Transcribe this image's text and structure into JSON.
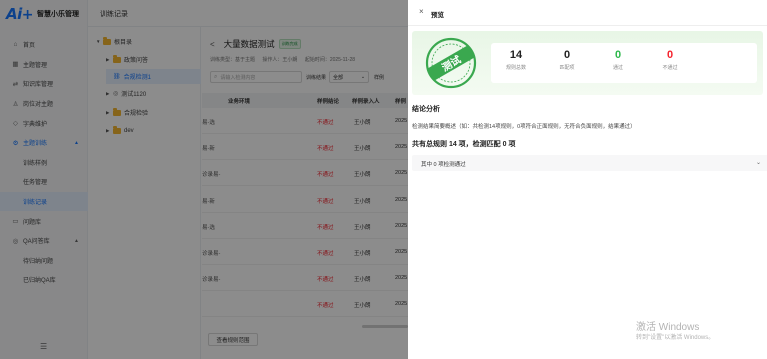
{
  "app": {
    "logo_text": "Ai",
    "name": "智慧小乐管理"
  },
  "header": {
    "title": "训练记录"
  },
  "sidebar": {
    "items": [
      {
        "icon": "home-icon",
        "glyph": "⌂",
        "label": "首页"
      },
      {
        "icon": "grid-icon",
        "glyph": "▦",
        "label": "主题管理"
      },
      {
        "icon": "transfer-icon",
        "glyph": "⇄",
        "label": "知识库管理"
      },
      {
        "icon": "user-icon",
        "glyph": "♙",
        "label": "岗位对主题"
      },
      {
        "icon": "shield-icon",
        "glyph": "◇",
        "label": "字典维护"
      },
      {
        "icon": "train-icon",
        "glyph": "⚙",
        "label": "主题训练"
      }
    ],
    "sub_items": [
      "训练样例",
      "任务管理",
      "训练记录"
    ],
    "items2": [
      {
        "icon": "book-icon",
        "glyph": "▭",
        "label": "问题库"
      },
      {
        "icon": "qa-icon",
        "glyph": "◎",
        "label": "QA问答库"
      }
    ],
    "sub_items2": [
      "待归纳问题",
      "已归纳QA库"
    ],
    "collapse_glyph": "☰"
  },
  "tree": {
    "nodes": [
      {
        "label": "根目录",
        "kind": "folder"
      },
      {
        "label": "政策问答",
        "kind": "folder"
      },
      {
        "label": "合规检测1",
        "kind": "link"
      },
      {
        "label": "测试1120",
        "kind": "ring"
      },
      {
        "label": "合规检验",
        "kind": "folder"
      },
      {
        "label": "dev",
        "kind": "folder"
      }
    ]
  },
  "content": {
    "back": "<",
    "title": "大量数据测试",
    "badge": "训练完成",
    "meta": [
      "训练类型：基于主题",
      "操作人：王小朗",
      "起始时间：2025-11-28"
    ],
    "search_placeholder": "请输入检测内容",
    "filter_label": "训练结果",
    "filter_value": "全部",
    "filter_label2": "样例",
    "columns": [
      "业务环境",
      "样例结论",
      "样例录入人",
      "样例"
    ],
    "rows": [
      {
        "env": "易-选",
        "result": "不通过",
        "owner": "王小朗",
        "date": "2025"
      },
      {
        "env": "易-新",
        "result": "不通过",
        "owner": "王小朗",
        "date": "2025"
      },
      {
        "env": "诊录易-",
        "result": "不通过",
        "owner": "王小朗",
        "date": "2025"
      },
      {
        "env": "易-新",
        "result": "不通过",
        "owner": "王小朗",
        "date": "2025"
      },
      {
        "env": "易-选",
        "result": "不通过",
        "owner": "王小朗",
        "date": "2025"
      },
      {
        "env": "诊录易-",
        "result": "不通过",
        "owner": "王小朗",
        "date": "2025"
      },
      {
        "env": "诊录易-",
        "result": "不通过",
        "owner": "王小朗",
        "date": "2025"
      },
      {
        "env": "",
        "result": "不通过",
        "owner": "王小朗",
        "date": "2025"
      }
    ],
    "view_button": "查看规则范围"
  },
  "drawer": {
    "close": "×",
    "title": "预览",
    "stamp_text": "测试",
    "stats": [
      {
        "value": "14",
        "label": "规则总数",
        "color": "#222222"
      },
      {
        "value": "0",
        "label": "匹配项",
        "color": "#222222"
      },
      {
        "value": "0",
        "label": "通过",
        "color": "#2db84c"
      },
      {
        "value": "0",
        "label": "不通过",
        "color": "#f5222d"
      }
    ],
    "section_title": "结论分析",
    "summary": "检测结果简要概述（如：共检测14项规则，0项符合正面规则，无符合负面规则，结果通过）",
    "total": "共有总规则 14 项，检测匹配 0 项",
    "collapse_text": "其中 0 项检测通过",
    "chevron": "⌄"
  },
  "watermark": {
    "line1": "激活 Windows",
    "line2": "转到\"设置\"以激活 Windows。"
  },
  "colors": {
    "primary": "#1677ff",
    "fail": "#f5222d",
    "pass": "#2db84c",
    "stamp": "#3aa84f"
  }
}
